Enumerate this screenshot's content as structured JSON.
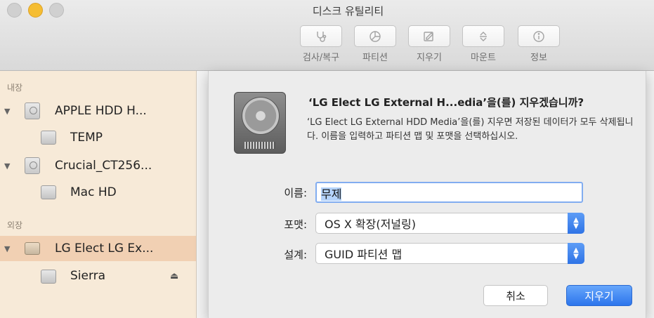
{
  "window": {
    "title": "디스크 유틸리티"
  },
  "toolbar": {
    "buttons": [
      {
        "label": "검사/복구",
        "icon": "stethoscope-icon"
      },
      {
        "label": "파티션",
        "icon": "pie-chart-icon"
      },
      {
        "label": "지우기",
        "icon": "erase-icon"
      },
      {
        "label": "마운트",
        "icon": "mount-icon"
      },
      {
        "label": "정보",
        "icon": "info-icon"
      }
    ]
  },
  "sidebar": {
    "internal_header": "내장",
    "external_header": "외장",
    "items": [
      {
        "label": "APPLE HDD H...",
        "kind": "disk"
      },
      {
        "label": "TEMP",
        "kind": "volume"
      },
      {
        "label": "Crucial_CT256...",
        "kind": "disk"
      },
      {
        "label": "Mac HD",
        "kind": "volume"
      },
      {
        "label": "LG Elect LG Ex...",
        "kind": "external-disk",
        "selected": true
      },
      {
        "label": "Sierra",
        "kind": "external-volume"
      }
    ]
  },
  "sheet": {
    "title": "‘LG Elect LG External H...edia’을(를) 지우겠습니까?",
    "message": "‘LG Elect LG External HDD Media’을(를) 지우면 저장된 데이터가 모두 삭제됩니다. 이름을 입력하고 파티션 맵 및 포맷을 선택하십시오.",
    "name_label": "이름:",
    "name_value": "무제",
    "format_label": "포맷:",
    "format_value": "OS X 확장(저널링)",
    "scheme_label": "설계:",
    "scheme_value": "GUID 파티션 맵",
    "cancel_label": "취소",
    "erase_label": "지우기"
  },
  "colors": {
    "sidebar_bg": "#f7ead8",
    "sidebar_selected": "#f1d0b3",
    "accent_blue": "#2d75ec"
  }
}
